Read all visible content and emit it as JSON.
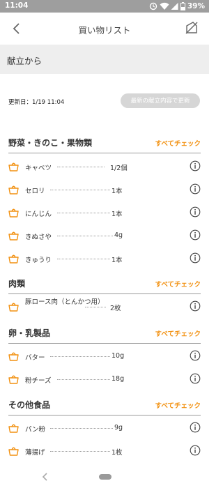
{
  "status_bar": {
    "time": "11:04",
    "battery": "39%",
    "icons": [
      "sync-icon",
      "wifi-icon",
      "signal-icon",
      "battery-icon"
    ]
  },
  "app_bar": {
    "title": "買い物リスト",
    "back_icon": "chevron-left-icon",
    "action_icon": "clear-list-icon"
  },
  "section": {
    "title": "献立から"
  },
  "update": {
    "date_text": "更新日：1/19 11:04",
    "button_label": "最新の献立内容で更新"
  },
  "accent_color": "#f29111",
  "categories": [
    {
      "title": "野菜・きのこ・果物類",
      "check_all": "すべてチェック",
      "items": [
        {
          "name": "キャベツ",
          "qty": "1/2個"
        },
        {
          "name": "セロリ",
          "qty": "1本"
        },
        {
          "name": "にんじん",
          "qty": "1本"
        },
        {
          "name": "きぬさや",
          "qty": "4g"
        },
        {
          "name": "きゅうり",
          "qty": "1本"
        }
      ]
    },
    {
      "title": "肉類",
      "check_all": "すべてチェック",
      "items": [
        {
          "name": "豚ロース肉（とんかつ用）",
          "qty": "2枚"
        }
      ]
    },
    {
      "title": "卵・乳製品",
      "check_all": "すべてチェック",
      "items": [
        {
          "name": "バター",
          "qty": "10g"
        },
        {
          "name": "粉チーズ",
          "qty": "18g"
        }
      ]
    },
    {
      "title": "その他食品",
      "check_all": "すべてチェック",
      "items": [
        {
          "name": "パン粉",
          "qty": "9g"
        },
        {
          "name": "薄揚げ",
          "qty": "1枚"
        }
      ]
    }
  ]
}
